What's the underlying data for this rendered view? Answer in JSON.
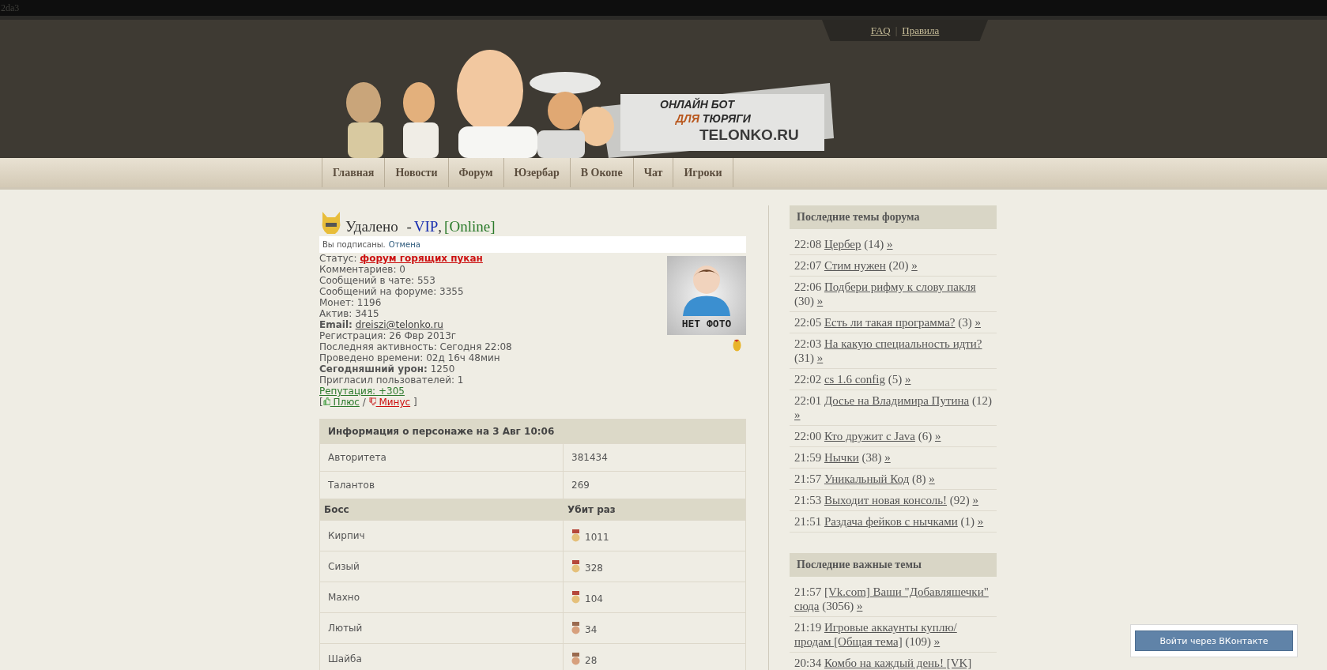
{
  "top_strip": {
    "text": "2da3"
  },
  "header": {
    "links": [
      "FAQ",
      "Правила"
    ],
    "link_separator": "|",
    "banner": {
      "kind": "picture",
      "logo_lines": [
        "ОНЛАЙН БОТ",
        "ДЛЯ",
        "ТЮРЯГИ",
        "TELONKO.RU"
      ]
    }
  },
  "nav": [
    "Главная",
    "Новости",
    "Форум",
    "Юзербар",
    "В Окопе",
    "Чат",
    "Игроки"
  ],
  "profile": {
    "name": "Удалено",
    "separator": "-",
    "rank": "VIP",
    "comma": ",",
    "online": "[Online]",
    "subscription": {
      "text": "Вы подписаны.",
      "link": "Отмена"
    },
    "fields": [
      {
        "kind": "status",
        "label": "Статус:",
        "value": "форум горящих пукан"
      },
      {
        "kind": "plain",
        "label": "Комментариев:",
        "value": "0"
      },
      {
        "kind": "plain",
        "label": "Сообщений в чате:",
        "value": "553"
      },
      {
        "kind": "plain",
        "label": "Сообщений на форуме:",
        "value": "3355"
      },
      {
        "kind": "plain",
        "label": "Монет:",
        "value": "1196"
      },
      {
        "kind": "plain",
        "label": "Актив:",
        "value": "3415"
      },
      {
        "kind": "email",
        "label": "Email:",
        "value": "dreiszi@telonko.ru"
      },
      {
        "kind": "plain",
        "label": "Регистрация:",
        "value": "26 Фвр 2013г"
      },
      {
        "kind": "plain",
        "label": "Последняя активность:",
        "value": "Сегодня 22:08"
      },
      {
        "kind": "plain",
        "label": "Проведено времени:",
        "value": "02д 16ч 48мин"
      },
      {
        "kind": "bold",
        "label": "Сегодняшний урон:",
        "value": "1250"
      },
      {
        "kind": "plain",
        "label": "Пригласил пользователей:",
        "value": "1"
      },
      {
        "kind": "reputation",
        "label": "Репутация:",
        "value": "+305"
      }
    ],
    "vote": {
      "open": "[",
      "plus": "Плюс",
      "slash": "/",
      "minus": "Минус",
      "close": "]"
    },
    "avatar": {
      "caption": "НЕТ ФОТО"
    }
  },
  "character": {
    "title": "Информация о персонаже на 3 Авг 10:06",
    "rows": [
      {
        "label": "Авторитета",
        "value": "381434"
      },
      {
        "label": "Талантов",
        "value": "269"
      }
    ],
    "columns": [
      "Босс",
      "Убит раз"
    ],
    "bosses": [
      {
        "name": "Кирпич",
        "kills": "1011",
        "kind": "gold"
      },
      {
        "name": "Сизый",
        "kills": "328",
        "kind": "gold"
      },
      {
        "name": "Махно",
        "kills": "104",
        "kind": "gold"
      },
      {
        "name": "Лютый",
        "kills": "34",
        "kind": "bronze"
      },
      {
        "name": "Шайба",
        "kills": "28",
        "kind": "bronze"
      }
    ]
  },
  "sidebar": [
    {
      "title": "Последние темы форума",
      "topics": [
        {
          "time": "22:08",
          "title": "Цербер",
          "count": "(14)",
          "more": "»"
        },
        {
          "time": "22:07",
          "title": "Стим нужен",
          "count": "(20)",
          "more": "»"
        },
        {
          "time": "22:06",
          "title": "Подбери рифму к слову пакля",
          "count": "(30)",
          "more": "»"
        },
        {
          "time": "22:05",
          "title": "Есть ли такая программа?",
          "count": "(3)",
          "more": "»"
        },
        {
          "time": "22:03",
          "title": "На какую специальность идти?",
          "count": "(31)",
          "more": "»"
        },
        {
          "time": "22:02",
          "title": "cs 1.6 config",
          "count": "(5)",
          "more": "»"
        },
        {
          "time": "22:01",
          "title": "Досье на Владимира Путина",
          "count": "(12)",
          "more": "»"
        },
        {
          "time": "22:00",
          "title": "Кто дружит с Java",
          "count": "(6)",
          "more": "»"
        },
        {
          "time": "21:59",
          "title": "Нычки",
          "count": "(38)",
          "more": "»"
        },
        {
          "time": "21:57",
          "title": "Уникальный Код",
          "count": "(8)",
          "more": "»"
        },
        {
          "time": "21:53",
          "title": "Выходит новая консоль!",
          "count": "(92)",
          "more": "»"
        },
        {
          "time": "21:51",
          "title": "Раздача фейков с нычками",
          "count": "(1)",
          "more": "»"
        }
      ]
    },
    {
      "title": "Последние важные темы",
      "topics": [
        {
          "time": "21:57",
          "title_lines": [
            "[Vk.com] Ваши \"Добавляшечки\"",
            "сюда"
          ],
          "count": "(3056)",
          "more": "»"
        },
        {
          "time": "21:19",
          "title_lines": [
            "Игровые аккаунты куплю/",
            "продам [Общая тема]"
          ],
          "count": "(109)",
          "more": "»"
        },
        {
          "time": "20:34",
          "title": "Комбо на каждый день! [VK]"
        }
      ]
    }
  ],
  "vk_button": "Войти через ВКонтакте"
}
